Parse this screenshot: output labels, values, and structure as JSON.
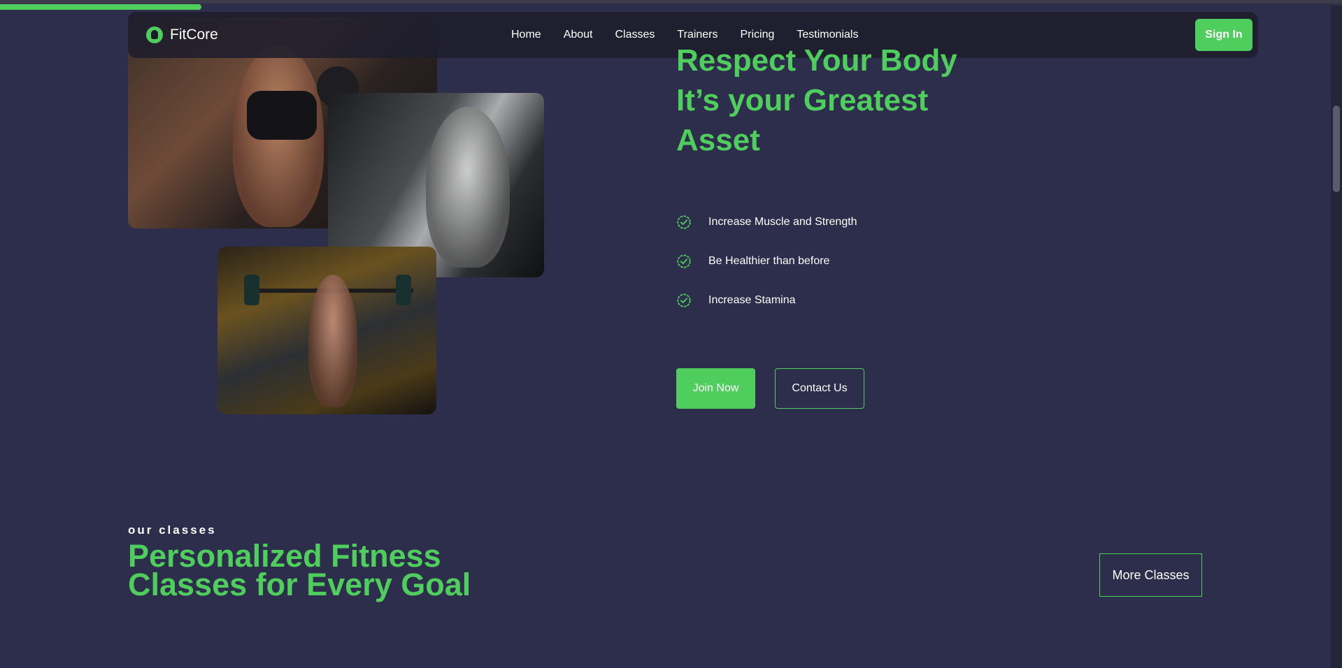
{
  "brand": {
    "name": "FitCore",
    "accent_color": "#4fce5d",
    "background_color": "#2d2d4c"
  },
  "page_load_progress": 0.15,
  "nav": {
    "links": [
      "Home",
      "About",
      "Classes",
      "Trainers",
      "Pricing",
      "Testimonials"
    ],
    "sign_in_label": "Sign In"
  },
  "hero": {
    "title_lines": [
      "Respect Your Body",
      "It’s your Greatest",
      "Asset"
    ],
    "features": [
      "Increase Muscle and Strength",
      "Be Healthier than before",
      "Increase Stamina"
    ],
    "feature_icon": "check-badge-icon",
    "join_label": "Join Now",
    "contact_label": "Contact Us"
  },
  "classes_section": {
    "eyebrow": "our classes",
    "title_lines": [
      "Personalized Fitness",
      "Classes for Every Goal"
    ],
    "more_label": "More Classes"
  }
}
